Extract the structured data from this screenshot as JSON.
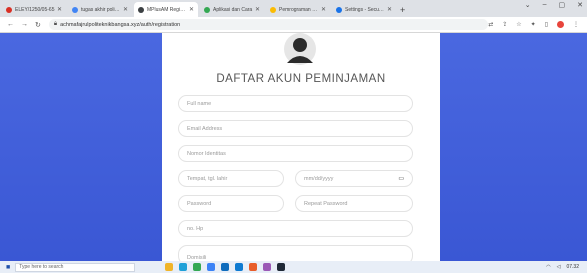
{
  "browser": {
    "tabs": [
      {
        "label": "ELEY/1250/05-65",
        "favicon_color": "#d93025",
        "active": false
      },
      {
        "label": "tugas akhir politeknik",
        "favicon_color": "#4285f4",
        "active": false
      },
      {
        "label": "MPlusAM Registration",
        "favicon_color": "#3c4043",
        "active": true
      },
      {
        "label": "Aplikasi dan Cara",
        "favicon_color": "#34a853",
        "active": false
      },
      {
        "label": "Pemrograman web",
        "favicon_color": "#fbbc04",
        "active": false
      },
      {
        "label": "Settings - Security",
        "favicon_color": "#1a73e8",
        "active": false
      }
    ],
    "new_tab_label": "+",
    "url": "achmafajrulpoliteknikbangsa.xyz/auth/registration",
    "window_controls": [
      "⌄",
      "–",
      "▢",
      "✕"
    ]
  },
  "form": {
    "title": "DAFTAR AKUN PEMINJAMAN",
    "full_name_placeholder": "Full name",
    "email_placeholder": "Email Address",
    "id_number_placeholder": "Nomor Identitas",
    "birthplace_placeholder": "Tempat, tgl. lahir",
    "birthdate_placeholder": "mm/dd/yyyy",
    "password_placeholder": "Password",
    "repeat_password_placeholder": "Repeat Password",
    "phone_placeholder": "no. Hp",
    "address_placeholder": "Domisili"
  },
  "taskbar": {
    "search_placeholder": "Type here to search",
    "time": "07.32"
  },
  "colors": {
    "side_panel": "#3f5fdc",
    "tabbar": "#dee1e6"
  }
}
